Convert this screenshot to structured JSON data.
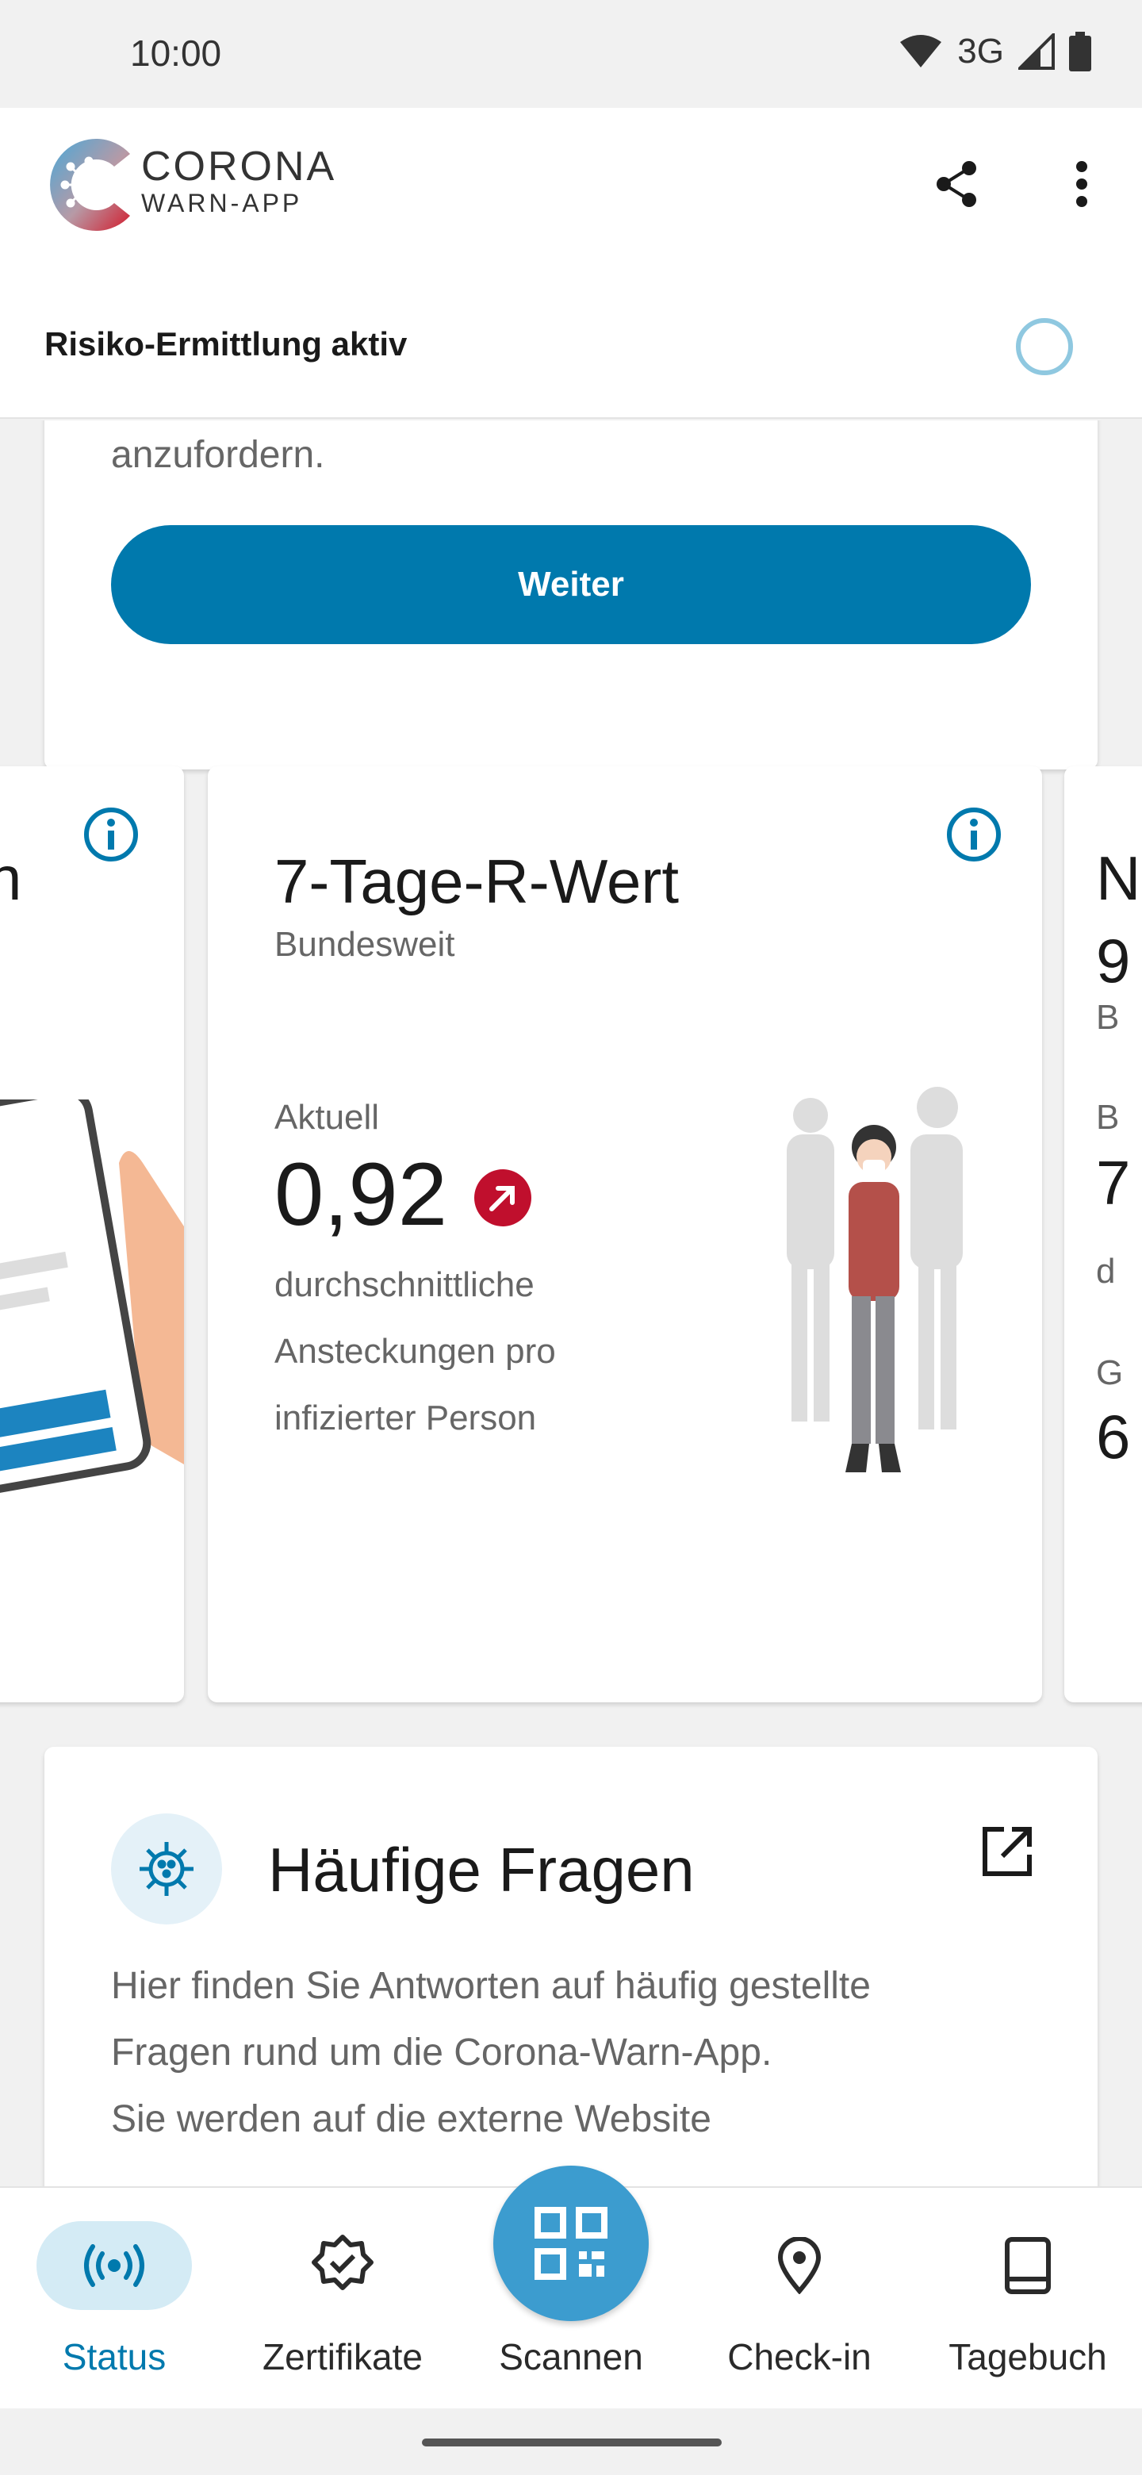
{
  "status_bar": {
    "time": "10:00",
    "network": "3G"
  },
  "app": {
    "brand_line1": "CORONA",
    "brand_line2": "WARN-APP"
  },
  "risk": {
    "label": "Risiko-Ermittlung aktiv"
  },
  "top_card": {
    "tail_text": "anzufordern.",
    "button_label": "Weiter"
  },
  "left_card": {
    "partial_title": "n"
  },
  "r_card": {
    "title": "7-Tage-R-Wert",
    "subtitle": "Bundesweit",
    "current_label": "Aktuell",
    "value": "0,92",
    "description": "durchschnittliche Ansteckungen pro infizierter Person"
  },
  "right_card": {
    "partial_title": "N",
    "partial_value": "9",
    "partial_sub": "B",
    "partial_label2": "B",
    "partial_value2": "7",
    "partial_small": "d",
    "partial_label3": "G",
    "partial_value3": "6"
  },
  "faq": {
    "title": "Häufige Fragen",
    "text_line1": "Hier finden Sie Antworten auf häufig gestellte",
    "text_line2": "Fragen rund um die Corona-Warn-App.",
    "text_line3": "Sie werden auf die externe Website"
  },
  "nav": {
    "items": [
      {
        "label": "Status",
        "icon": "status-icon",
        "active": true
      },
      {
        "label": "Zertifikate",
        "icon": "certificate-icon"
      },
      {
        "label": "Scannen",
        "icon": "qr-scan-icon"
      },
      {
        "label": "Check-in",
        "icon": "location-pin-icon"
      },
      {
        "label": "Tagebuch",
        "icon": "book-icon"
      }
    ]
  },
  "colors": {
    "primary": "#0079ad",
    "fab": "#3c9ccf",
    "trend_up": "#c00f2d",
    "active_pill": "#d4ebf5"
  }
}
